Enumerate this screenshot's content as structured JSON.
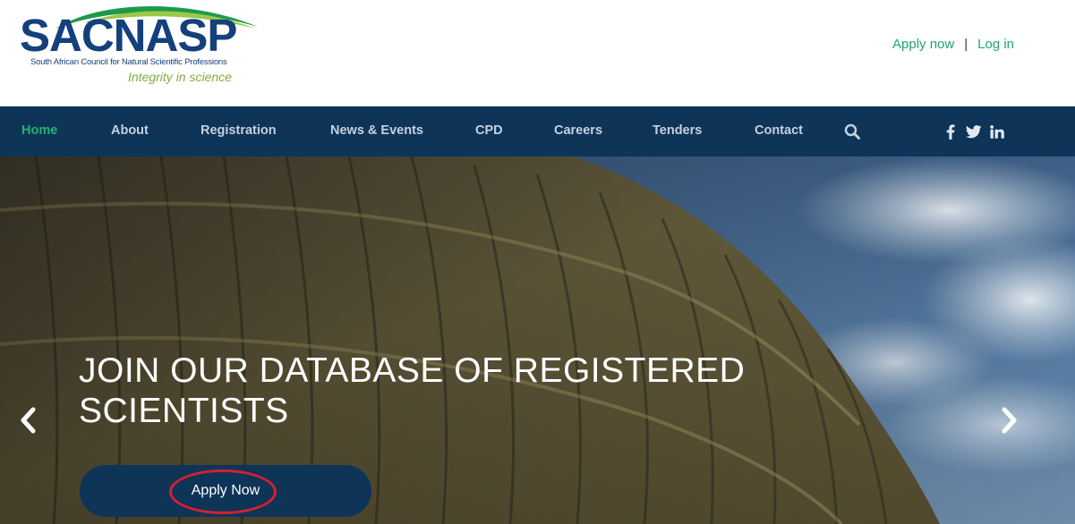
{
  "logo": {
    "wordmark": "SACNASP",
    "subtitle": "South African Council for Natural Scientific Professions",
    "tagline": "Integrity in science"
  },
  "top_links": {
    "apply": "Apply now",
    "separator": "|",
    "login": "Log in"
  },
  "nav": {
    "items": [
      {
        "label": "Home",
        "active": true
      },
      {
        "label": "About"
      },
      {
        "label": "Registration"
      },
      {
        "label": "News & Events"
      },
      {
        "label": "CPD"
      },
      {
        "label": "Careers"
      },
      {
        "label": "Tenders"
      },
      {
        "label": "Contact"
      }
    ],
    "search_icon": "search-icon",
    "social": [
      "facebook-icon",
      "twitter-icon",
      "linkedin-icon"
    ]
  },
  "hero": {
    "title": "JOIN OUR DATABASE OF REGISTERED SCIENTISTS",
    "button_label": "Apply Now",
    "prev_icon": "chevron-left-icon",
    "next_icon": "chevron-right-icon"
  },
  "colors": {
    "brand_navy": "#0e3458",
    "brand_green": "#23b36f",
    "annotation_red": "#d6202f"
  }
}
